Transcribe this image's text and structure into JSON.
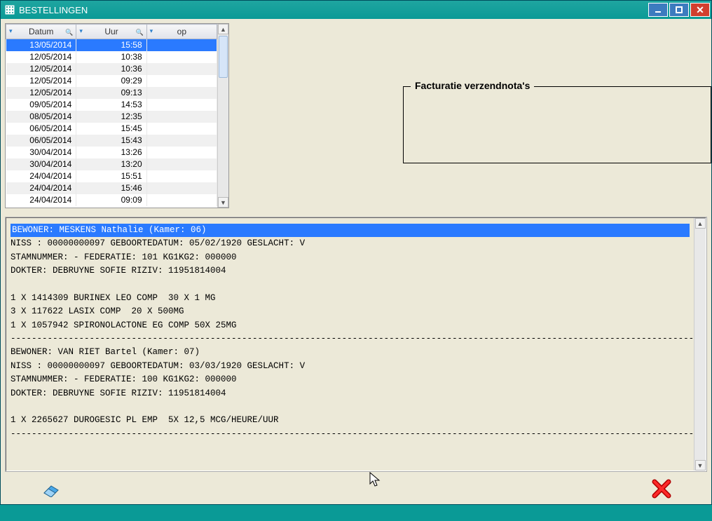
{
  "window": {
    "title": "BESTELLINGEN"
  },
  "grid": {
    "columns": {
      "datum": "Datum",
      "uur": "Uur",
      "op": "op"
    },
    "rows": [
      {
        "datum": "13/05/2014",
        "uur": "15:58",
        "op": "",
        "selected": true
      },
      {
        "datum": "12/05/2014",
        "uur": "10:38",
        "op": ""
      },
      {
        "datum": "12/05/2014",
        "uur": "10:36",
        "op": ""
      },
      {
        "datum": "12/05/2014",
        "uur": "09:29",
        "op": ""
      },
      {
        "datum": "12/05/2014",
        "uur": "09:13",
        "op": ""
      },
      {
        "datum": "09/05/2014",
        "uur": "14:53",
        "op": ""
      },
      {
        "datum": "08/05/2014",
        "uur": "12:35",
        "op": ""
      },
      {
        "datum": "06/05/2014",
        "uur": "15:45",
        "op": ""
      },
      {
        "datum": "06/05/2014",
        "uur": "15:43",
        "op": ""
      },
      {
        "datum": "30/04/2014",
        "uur": "13:26",
        "op": ""
      },
      {
        "datum": "30/04/2014",
        "uur": "13:20",
        "op": ""
      },
      {
        "datum": "24/04/2014",
        "uur": "15:51",
        "op": ""
      },
      {
        "datum": "24/04/2014",
        "uur": "15:46",
        "op": ""
      },
      {
        "datum": "24/04/2014",
        "uur": "09:09",
        "op": ""
      }
    ]
  },
  "fieldset": {
    "legend": "Facturatie verzendnota's"
  },
  "detail": {
    "highlight": "BEWONER: MESKENS Nathalie (Kamer: 06)",
    "l01": "NISS : 00000000097 GEBOORTEDATUM: 05/02/1920 GESLACHT: V",
    "l02": "STAMNUMMER: - FEDERATIE: 101 KG1KG2: 000000",
    "l03": "DOKTER: DEBRUYNE SOFIE RIZIV: 11951814004",
    "l04": "",
    "l05": "1 X 1414309 BURINEX LEO COMP  30 X 1 MG",
    "l06": "3 X 117622 LASIX COMP  20 X 500MG",
    "l07": "1 X 1057942 SPIRONOLACTONE EG COMP 50X 25MG",
    "sep1": "--------------------------------------------------------------------------------------------------------------------------------------------------------",
    "l08": "BEWONER: VAN RIET Bartel (Kamer: 07)",
    "l09": "NISS : 00000000097 GEBOORTEDATUM: 03/03/1920 GESLACHT: V",
    "l10": "STAMNUMMER: - FEDERATIE: 100 KG1KG2: 000000",
    "l11": "DOKTER: DEBRUYNE SOFIE RIZIV: 11951814004",
    "l12": "",
    "l13": "1 X 2265627 DUROGESIC PL EMP  5X 12,5 MCG/HEURE/UUR",
    "sep2": "--------------------------------------------------------------------------------------------------------------------------------------------------------"
  }
}
